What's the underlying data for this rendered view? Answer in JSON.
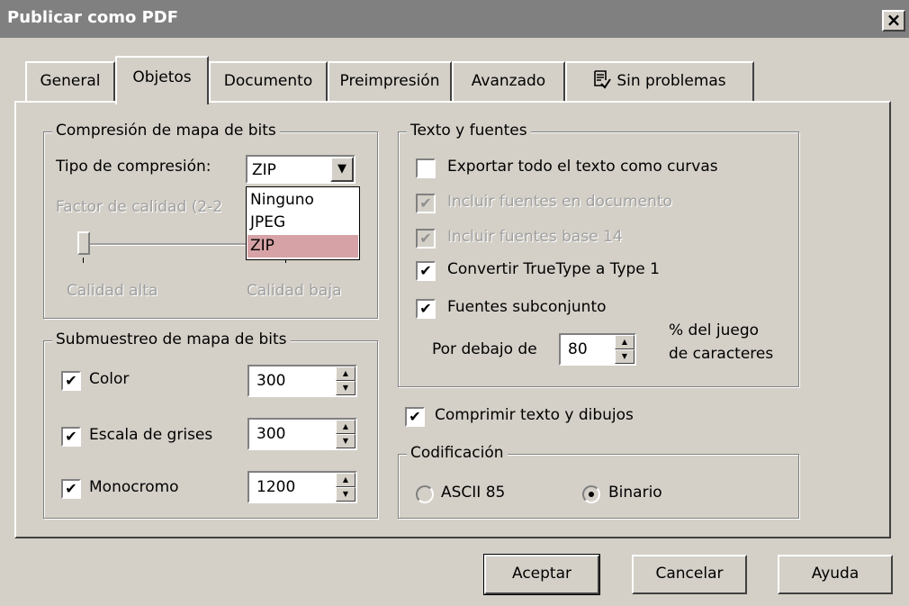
{
  "window": {
    "title": "Publicar como PDF",
    "close": "×"
  },
  "tabs": [
    {
      "label": "General"
    },
    {
      "label": "Objetos",
      "active": true
    },
    {
      "label": "Documento"
    },
    {
      "label": "Preimpresión"
    },
    {
      "label": "Avanzado"
    },
    {
      "label": "Sin problemas",
      "icon": "document-check-icon"
    }
  ],
  "compression": {
    "legend": "Compresión de mapa de bits",
    "type_label": "Tipo de compresión:",
    "type_value": "ZIP",
    "options": [
      "Ninguno",
      "JPEG",
      "ZIP"
    ],
    "quality_label": "Factor de calidad (2-2",
    "high_label": "Calidad alta",
    "low_label": "Calidad baja"
  },
  "downsampling": {
    "legend": "Submuestreo de mapa de bits",
    "items": [
      {
        "label": "Color",
        "checked": true,
        "value": "300"
      },
      {
        "label": "Escala de grises",
        "checked": true,
        "value": "300"
      },
      {
        "label": "Monocromo",
        "checked": true,
        "value": "1200"
      }
    ]
  },
  "text_fonts": {
    "legend": "Texto y fuentes",
    "export_curves": {
      "label": "Exportar todo el texto como curvas",
      "checked": false
    },
    "embed_fonts": {
      "label": "Incluir fuentes en documento",
      "checked": true,
      "disabled": true
    },
    "base14": {
      "label": "Incluir fuentes base 14",
      "checked": true,
      "disabled": true
    },
    "truetype": {
      "label": "Convertir TrueType a Type 1",
      "checked": true
    },
    "subset": {
      "label": "Fuentes subconjunto",
      "checked": true
    },
    "below_label": "Por debajo de",
    "below_value": "80",
    "charset_line1": "% del juego",
    "charset_line2": "de caracteres"
  },
  "compress_text": {
    "label": "Comprimir texto y dibujos",
    "checked": true
  },
  "encoding": {
    "legend": "Codificación",
    "ascii": {
      "label": "ASCII 85",
      "selected": false
    },
    "binary": {
      "label": "Binario",
      "selected": true
    }
  },
  "buttons": {
    "ok": "Aceptar",
    "cancel": "Cancelar",
    "help": "Ayuda"
  },
  "glyphs": {
    "check": "✔",
    "up": "▲",
    "down": "▼"
  }
}
